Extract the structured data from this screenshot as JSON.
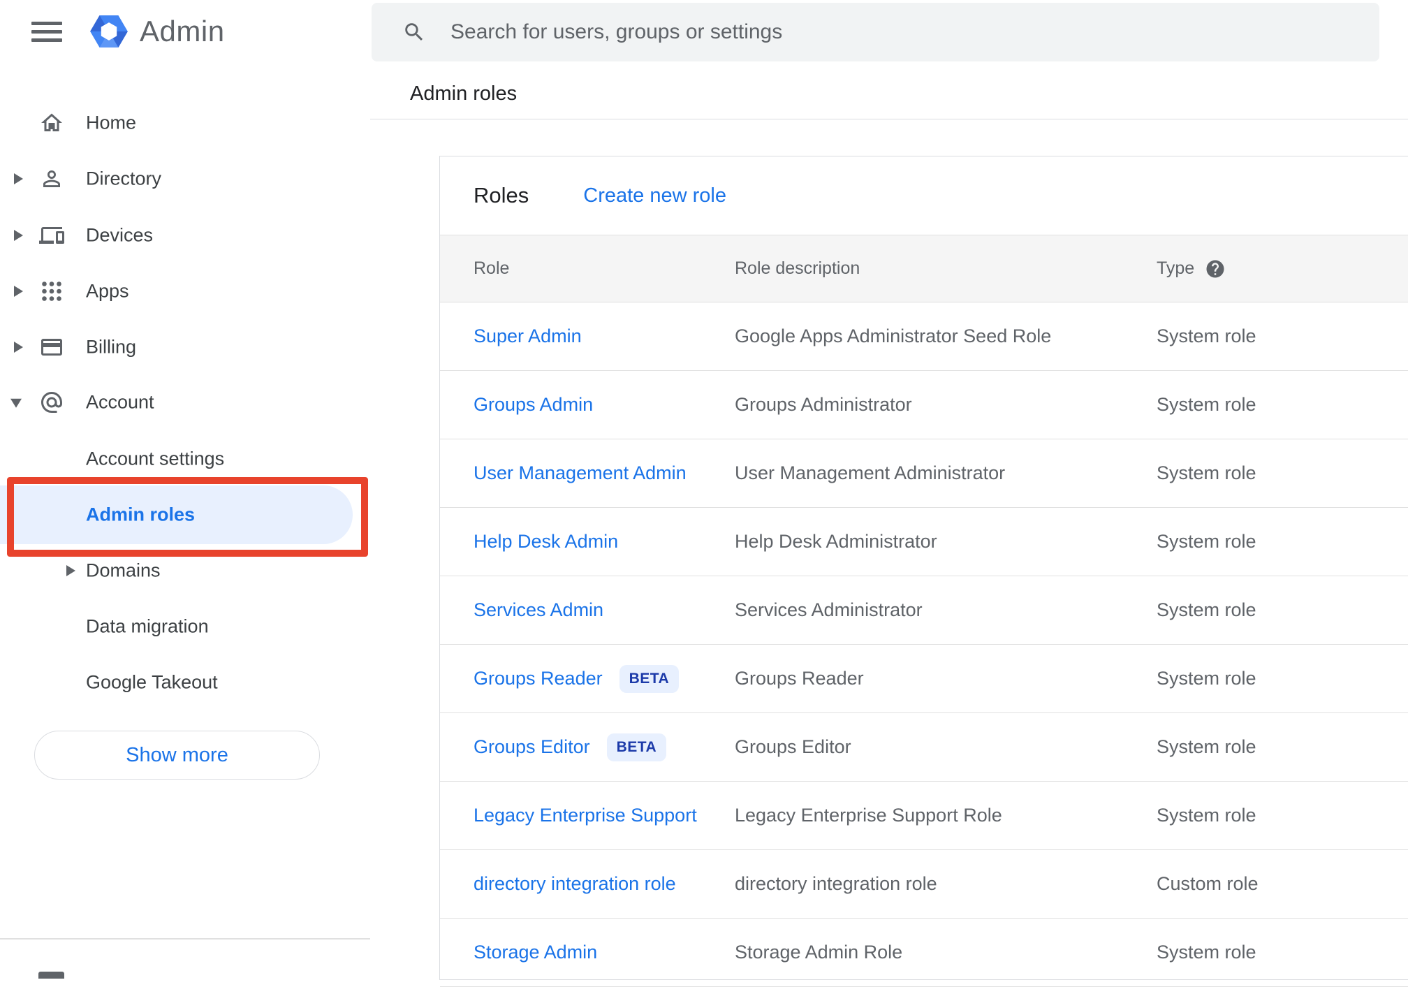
{
  "brand": {
    "app_name": "Admin"
  },
  "topbar": {
    "search_placeholder": "Search for users, groups or settings"
  },
  "breadcrumb": {
    "current": "Admin roles"
  },
  "sidebar": {
    "items": [
      {
        "label": "Home",
        "icon": "home",
        "arrow": "none",
        "level": 0,
        "selected": false
      },
      {
        "label": "Directory",
        "icon": "person",
        "arrow": "right",
        "level": 0,
        "selected": false
      },
      {
        "label": "Devices",
        "icon": "devices",
        "arrow": "right",
        "level": 0,
        "selected": false
      },
      {
        "label": "Apps",
        "icon": "apps",
        "arrow": "right",
        "level": 0,
        "selected": false
      },
      {
        "label": "Billing",
        "icon": "card",
        "arrow": "right",
        "level": 0,
        "selected": false
      },
      {
        "label": "Account",
        "icon": "at",
        "arrow": "down",
        "level": 0,
        "selected": false
      },
      {
        "label": "Account settings",
        "icon": "",
        "arrow": "none",
        "level": 1,
        "selected": false
      },
      {
        "label": "Admin roles",
        "icon": "",
        "arrow": "none",
        "level": 1,
        "selected": true
      },
      {
        "label": "Domains",
        "icon": "",
        "arrow": "right",
        "level": 1,
        "selected": false
      },
      {
        "label": "Data migration",
        "icon": "",
        "arrow": "none",
        "level": 1,
        "selected": false
      },
      {
        "label": "Google Takeout",
        "icon": "",
        "arrow": "none",
        "level": 1,
        "selected": false
      }
    ],
    "show_more_label": "Show more"
  },
  "roles": {
    "title": "Roles",
    "create_link": "Create new role",
    "columns": [
      "Role",
      "Role description",
      "Type"
    ],
    "rows": [
      {
        "role": "Super Admin",
        "badge": "",
        "description": "Google Apps Administrator Seed Role",
        "type": "System role"
      },
      {
        "role": "Groups Admin",
        "badge": "",
        "description": "Groups Administrator",
        "type": "System role"
      },
      {
        "role": "User Management Admin",
        "badge": "",
        "description": "User Management Administrator",
        "type": "System role"
      },
      {
        "role": "Help Desk Admin",
        "badge": "",
        "description": "Help Desk Administrator",
        "type": "System role"
      },
      {
        "role": "Services Admin",
        "badge": "",
        "description": "Services Administrator",
        "type": "System role"
      },
      {
        "role": "Groups Reader",
        "badge": "BETA",
        "description": "Groups Reader",
        "type": "System role"
      },
      {
        "role": "Groups Editor",
        "badge": "BETA",
        "description": "Groups Editor",
        "type": "System role"
      },
      {
        "role": "Legacy Enterprise Support",
        "badge": "",
        "description": "Legacy Enterprise Support Role",
        "type": "System role"
      },
      {
        "role": "directory integration role",
        "badge": "",
        "description": "directory integration role",
        "type": "Custom role"
      },
      {
        "role": "Storage Admin",
        "badge": "",
        "description": "Storage Admin Role",
        "type": "System role"
      }
    ]
  },
  "colors": {
    "accent": "#1a73e8",
    "selected-bg": "#e8f0fe",
    "annotation-red": "#e8432c",
    "text-dark": "#202124",
    "text-gray": "#5f6368",
    "beta-text": "#1c3aa9",
    "beta-bg": "#e8f0fe"
  }
}
